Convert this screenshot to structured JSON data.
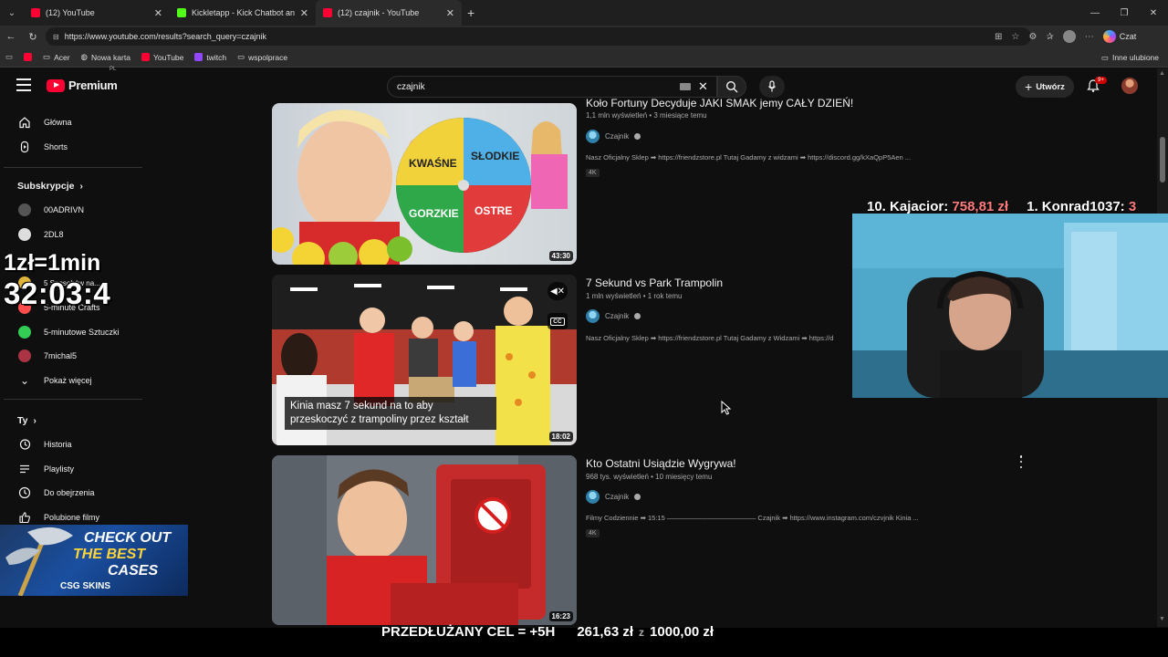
{
  "browser": {
    "tabs": [
      {
        "title": "(12) YouTube",
        "color": "#ff0033",
        "active": false
      },
      {
        "title": "Kickletapp - Kick Chatbot and Ov",
        "color": "#53fc18",
        "active": false
      },
      {
        "title": "(12) czajnik - YouTube",
        "color": "#ff0033",
        "active": true
      }
    ],
    "url": "https://www.youtube.com/results?search_query=czajnik",
    "copilot_label": "Czat",
    "bookmarks": [
      "Acer",
      "Nowa karta",
      "YouTube",
      "twitch",
      "wspolprace"
    ],
    "bookmarks_other": "Inne ulubione"
  },
  "youtube": {
    "logo_text": "Premium",
    "logo_region": "PL",
    "search_value": "czajnik",
    "create_label": "Utwórz",
    "notification_count": "9+"
  },
  "sidebar": {
    "main": [
      {
        "label": "Główna",
        "icon": "home-icon"
      },
      {
        "label": "Shorts",
        "icon": "shorts-icon"
      }
    ],
    "subscriptions_title": "Subskrypcje",
    "subscriptions": [
      {
        "label": "00ADRIVN",
        "color": "#555555"
      },
      {
        "label": "2DL8",
        "color": "#dddddd"
      },
      {
        "label": "5 Sposobów na...",
        "color": "#e0b43a"
      },
      {
        "label": "5-minute Crafts",
        "color": "#ff4d4d"
      },
      {
        "label": "5-minutowe Sztuczki",
        "color": "#33cc55"
      },
      {
        "label": "7michal5",
        "color": "#aa3344"
      }
    ],
    "show_more": "Pokaż więcej",
    "you_title": "Ty",
    "you_items": [
      {
        "label": "Historia",
        "icon": "history-icon"
      },
      {
        "label": "Playlisty",
        "icon": "playlist-icon"
      },
      {
        "label": "Do obejrzenia",
        "icon": "watch-later-icon"
      },
      {
        "label": "Polubione filmy",
        "icon": "like-icon"
      }
    ]
  },
  "results": [
    {
      "title": "Koło Fortuny Decyduje JAKI SMAK jemy CAŁY DZIEŃ!",
      "meta": "1,1 mln wyświetleń • 3 miesiące temu",
      "channel": "Czajnik",
      "description": "Nasz Oficjalny Sklep ➡ https://friendzstore.pl Tutaj Gadamy z widzami ➡ https://discord.gg/kXaQpP5Aen ...",
      "badge": "4K",
      "duration": "43:30",
      "thumb_words": [
        "KWAŚNE",
        "SŁODKIE",
        "GORZKIE",
        "OSTRE"
      ]
    },
    {
      "title": "7 Sekund vs Park Trampolin",
      "meta": "1 mln wyświetleń • 1 rok temu",
      "channel": "Czajnik",
      "description": "Nasz Oficjalny Sklep ➡ https://friendzstore.pl Tutaj Gadamy z Widzami ➡ https://d",
      "badge": "",
      "duration": "18:02",
      "caption": "Kinia masz 7 sekund na to aby przeskoczyć z trampoliny przez kształt",
      "cc_label": "CC"
    },
    {
      "title": "Kto Ostatni Usiądzie Wygrywa!",
      "meta": "968 tys. wyświetleń • 10 miesięcy temu",
      "channel": "Czajnik",
      "description": "Filmy Codziennie ➡ 15:15 ————————————— Czajnik ➡ https://www.instagram.com/czvjnik Kinia ...",
      "badge": "4K",
      "duration": "16:23"
    }
  ],
  "overlay": {
    "timer_rate": "1zł=1min",
    "timer_value": "32:03:4",
    "leaderboard": [
      {
        "rank": "10. Kajacior:",
        "amount": "758,81 zł"
      },
      {
        "rank": "1. Konrad1037:",
        "amount": "3"
      }
    ],
    "ad_line1": "CHECK OUT",
    "ad_line2": "THE BEST",
    "ad_line3": "CASES",
    "ad_brand": "CSG SKINS",
    "goal_label": "PRZEDŁUŻANY CEL = +5H",
    "goal_current": "261,63 zł",
    "goal_sep": "z",
    "goal_target": "1000,00 zł"
  }
}
